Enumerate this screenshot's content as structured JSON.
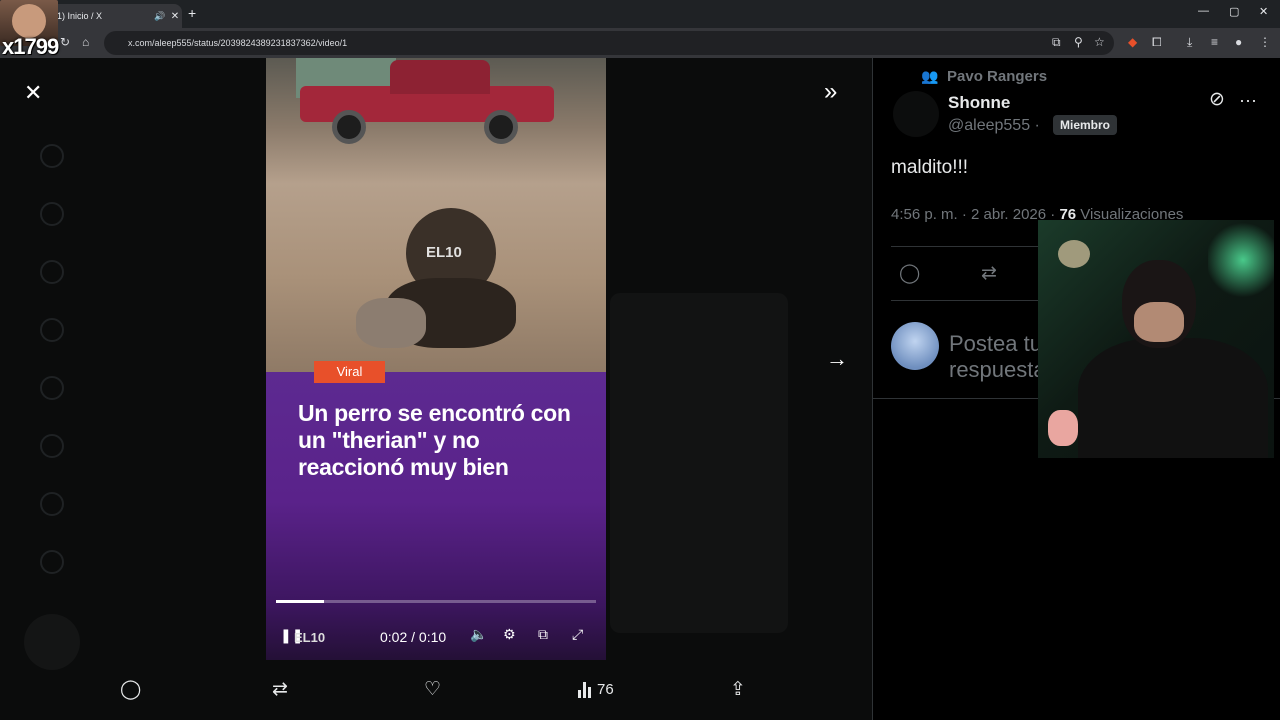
{
  "browser": {
    "tab_title": "(1) Inicio / X",
    "url": "x.com/aleep555/status/2039824389231837362/video/1"
  },
  "streamer_overlay": {
    "handle": "x1799"
  },
  "video": {
    "badge": "Viral",
    "headline": "Un perro se encontró con un \"therian\" y no reaccionó muy bien",
    "watermark": "EL10",
    "control_logo": "EL10",
    "time": "0:02 / 0:10",
    "progress": 0.15
  },
  "action_bar": {
    "views": "76"
  },
  "tweet": {
    "community": "Pavo Rangers",
    "author_name": "Shonne",
    "author_handle": "@aleep555",
    "separator": "·",
    "member_badge": "Miembro",
    "text": "maldito!!!",
    "timestamp": "4:56 p. m. · 2 abr. 2026 ·",
    "views_count": "76",
    "views_label": "Visualizaciones",
    "reply_placeholder": "Postea tu respuesta"
  },
  "colors": {
    "background": "#000000",
    "video_purple": "#5d2a91",
    "viral_badge": "#e8502a",
    "muted_text": "#71767b"
  },
  "icons": [
    "close-icon",
    "double-chevron-icon",
    "arrow-right-icon",
    "reply-icon",
    "repost-icon",
    "like-icon",
    "views-icon",
    "share-icon",
    "grok-icon",
    "more-icon",
    "pause-icon",
    "volume-icon",
    "settings-icon",
    "pip-icon",
    "fullscreen-icon"
  ]
}
